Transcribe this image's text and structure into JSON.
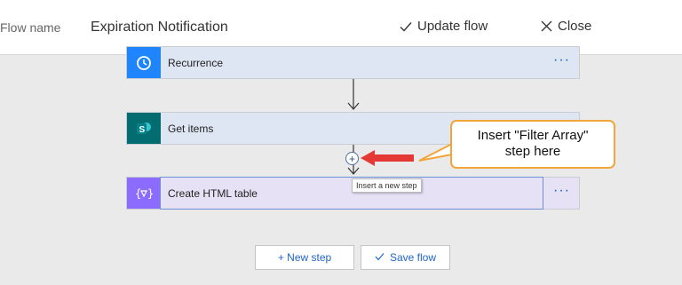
{
  "header": {
    "flow_name_label": "Flow name",
    "flow_name_value": "Expiration Notification",
    "update_label": "Update flow",
    "close_label": "Close"
  },
  "steps": [
    {
      "label": "Recurrence",
      "icon": "clock-icon",
      "color": "#1f85ff"
    },
    {
      "label": "Get items",
      "icon": "sharepoint-icon",
      "color": "#036c70"
    },
    {
      "label": "Create HTML table",
      "icon": "data-operation-icon",
      "color": "#8c6cff"
    }
  ],
  "more_options_glyph": "···",
  "insert": {
    "tooltip": "Insert a new step"
  },
  "callout": {
    "line1": "Insert \"Filter Array\"",
    "line2": "step here",
    "border_color": "#f2a53a"
  },
  "arrow_color": "#e53935",
  "bottom": {
    "new_step_label": "+ New step",
    "save_label": "Save flow"
  }
}
